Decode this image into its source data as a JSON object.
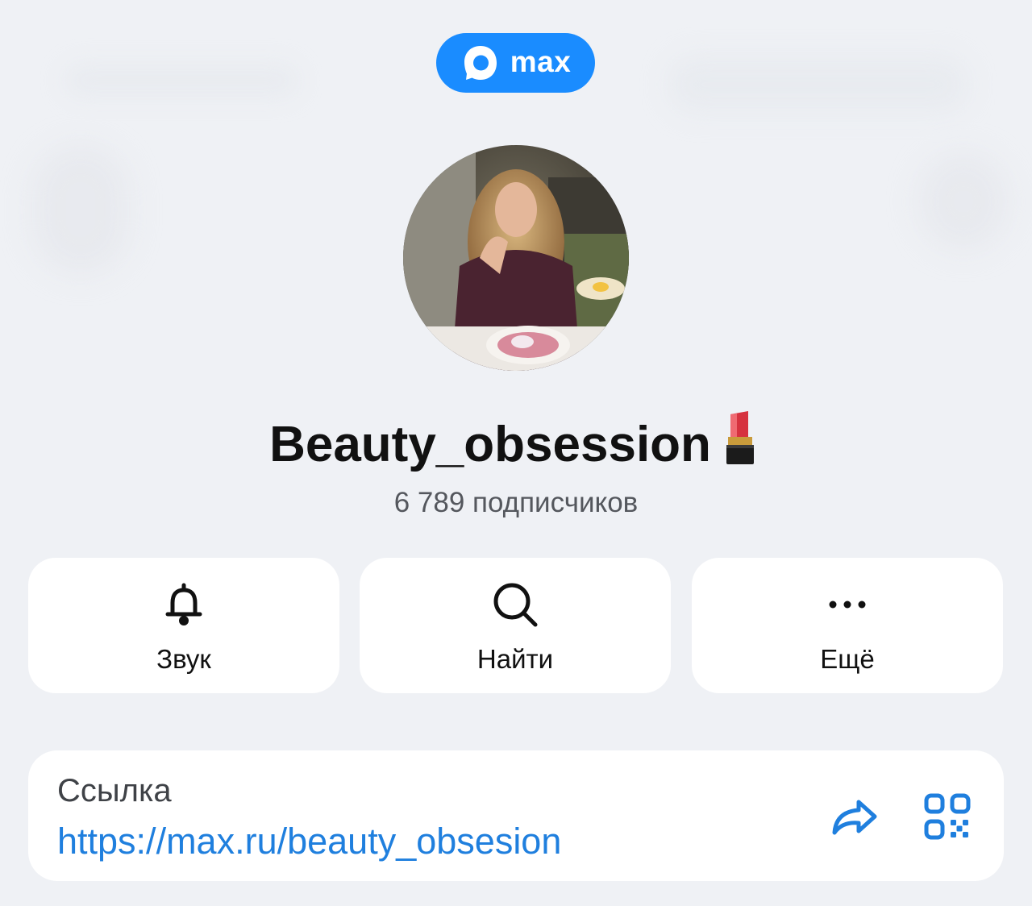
{
  "app": {
    "brand_label": "max",
    "accent_color": "#1a8cff",
    "link_color": "#1f7fde",
    "background_color": "#eff1f5"
  },
  "channel": {
    "title": "Beauty_obsession",
    "title_emoji": "lipstick-icon",
    "subscribers": "6 789 подписчиков",
    "avatar": "channel-avatar-photo"
  },
  "actions": [
    {
      "label": "Звук",
      "icon": "bell-icon"
    },
    {
      "label": "Найти",
      "icon": "search-icon"
    },
    {
      "label": "Ещё",
      "icon": "more-dots-icon"
    }
  ],
  "link_card": {
    "caption": "Ссылка",
    "url": "https://max.ru/beauty_obsesion",
    "share_icon": "share-icon",
    "qr_icon": "qr-code-icon"
  }
}
